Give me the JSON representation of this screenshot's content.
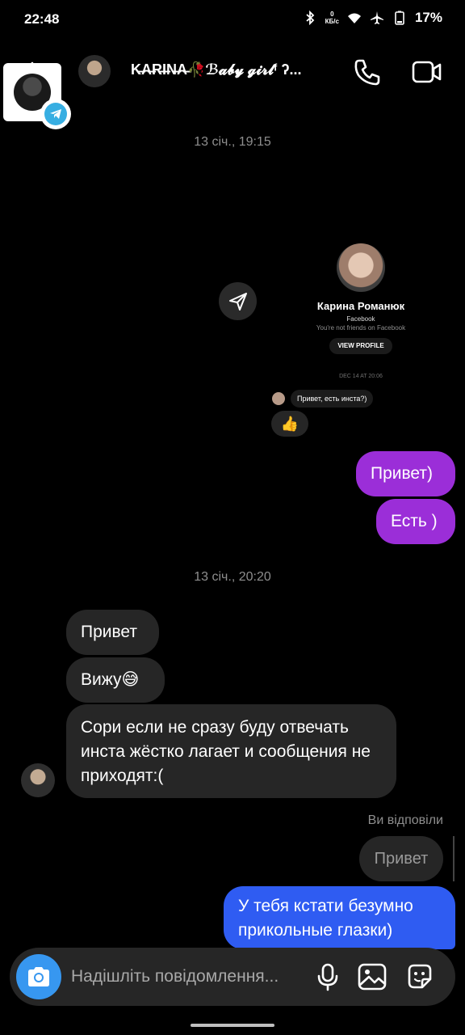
{
  "status_bar": {
    "time": "22:48",
    "net_speed": "0",
    "net_unit": "КБ/с",
    "battery": "17%"
  },
  "header": {
    "contact_name": "K̶A̶R̶I̶N̶A̶🥀ℬ𝓪𝓫𝔂 𝓰𝓲𝓻𝓵ᶠ ʔ..."
  },
  "timestamps": [
    "13 січ., 19:15",
    "13 січ., 20:20"
  ],
  "shared_card": {
    "name": "Карина Романюк",
    "source": "Facebook",
    "note": "You're not friends on Facebook",
    "view_profile": "VIEW PROFILE",
    "date": "DEC 14 AT 20:06",
    "message": "Привет, есть инста?)",
    "reaction": "👍"
  },
  "messages_outgoing": [
    "Привет)",
    "Есть )"
  ],
  "messages_incoming": [
    "Привет",
    "Вижу😅",
    "Сори если не сразу буду отвечать инста жёстко лагает и сообщения не приходят:("
  ],
  "reply": {
    "label": "Ви відповіли",
    "quoted": "Привет",
    "text": "У тебя кстати безумно прикольные глазки)"
  },
  "composer": {
    "placeholder": "Надішліть повідомлення..."
  },
  "colors": {
    "outgoing_purple": "#9b2ed8",
    "reply_blue": "#2f5cf2",
    "camera_blue": "#3797f0",
    "incoming_gray": "#262626"
  }
}
